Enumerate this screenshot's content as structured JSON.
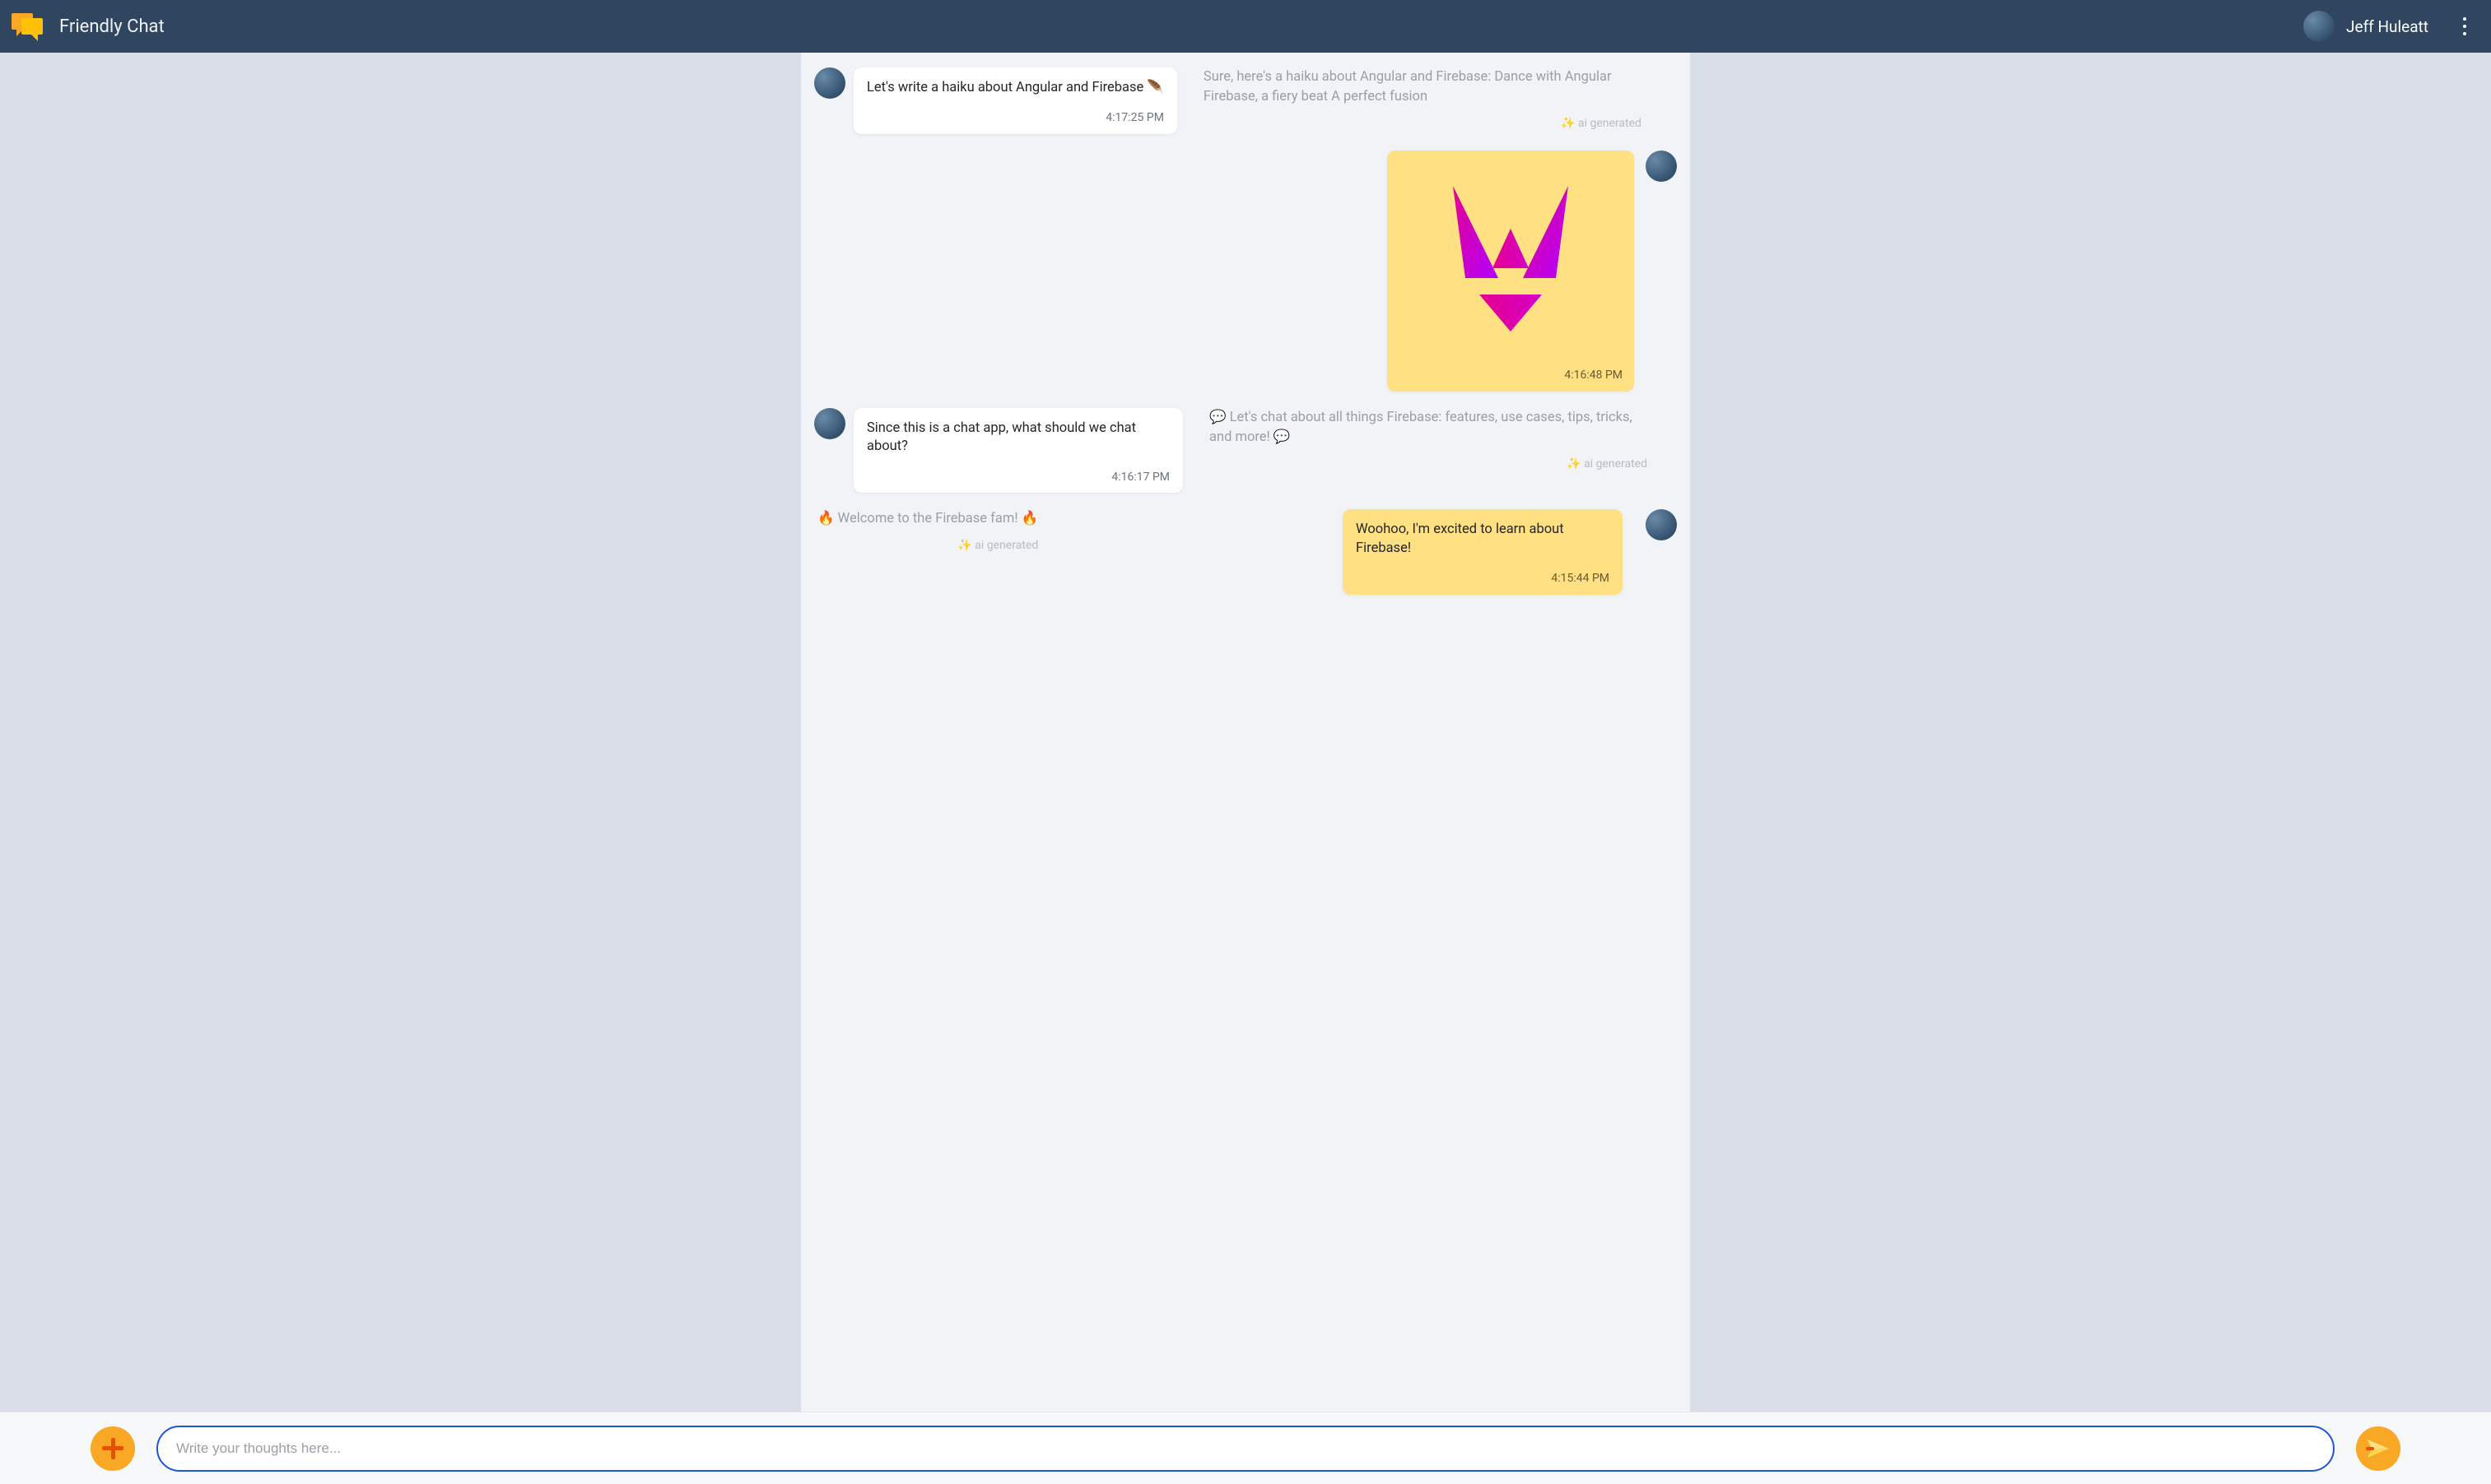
{
  "header": {
    "app_title": "Friendly Chat",
    "user_name": "Jeff Huleatt"
  },
  "ai_generated_label": "✨ ai generated",
  "messages": [
    {
      "id": "m1",
      "side": "left",
      "bubble_text": "Let's write a haiku about Angular and Firebase 🪶",
      "timestamp": "4:17:25 PM",
      "ai_text": "Sure, here's a haiku about Angular and Firebase: Dance with Angular Firebase, a fiery beat A perfect fusion"
    },
    {
      "id": "m2",
      "side": "right",
      "kind": "image",
      "timestamp": "4:16:48 PM",
      "image_alt": "angular-logo"
    },
    {
      "id": "m3",
      "side": "left",
      "bubble_text": "Since this is a chat app, what should we chat about?",
      "timestamp": "4:16:17 PM",
      "ai_text": "💬 Let's chat about all things Firebase: features, use cases, tips, tricks, and more! 💬"
    },
    {
      "id": "m4",
      "side": "right",
      "bubble_text": "Woohoo, I'm excited to learn about Firebase!",
      "timestamp": "4:15:44 PM",
      "ai_text": "🔥 Welcome to the Firebase fam! 🔥"
    }
  ],
  "composer": {
    "placeholder": "Write your thoughts here..."
  }
}
